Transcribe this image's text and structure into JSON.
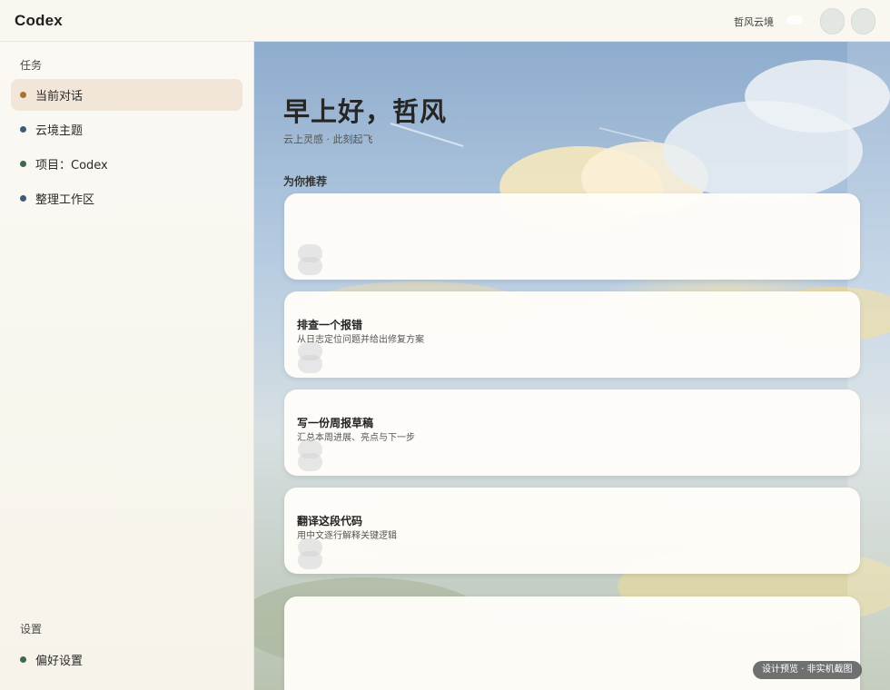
{
  "app": {
    "title": "Codex",
    "workspace_name": "哲风云境"
  },
  "sidebar": {
    "tasks_label": "任务",
    "items": [
      {
        "label": "当前对话",
        "dot_color": "#a7762e",
        "active": true
      },
      {
        "label": "云境主题",
        "dot_color": "#3c5a7c",
        "active": false
      },
      {
        "label": "项目：Codex",
        "dot_color": "#3e6a4a",
        "active": false
      },
      {
        "label": "整理工作区",
        "dot_color": "#3c5a7c",
        "active": false
      }
    ],
    "settings_label": "设置",
    "settings_item": {
      "label": "偏好设置",
      "dot_color": "#3e6a4a"
    }
  },
  "main": {
    "greeting": "早上好，哲风",
    "subtitle": "云上灵感 · 此刻起飞",
    "recommend_label": "为你推荐",
    "cards": [
      {
        "title": "",
        "description": ""
      },
      {
        "title": "排查一个报错",
        "description": "从日志定位问题并给出修复方案"
      },
      {
        "title": "写一份周报草稿",
        "description": "汇总本周进展、亮点与下一步"
      },
      {
        "title": "翻译这段代码",
        "description": "用中文逐行解释关键逻辑"
      }
    ]
  },
  "footer": {
    "badge": "设计预览 · 非实机截图"
  },
  "colors": {
    "accent": "#f1e6d8",
    "sky": "#9fb8d4",
    "card": "#fffdf9"
  }
}
